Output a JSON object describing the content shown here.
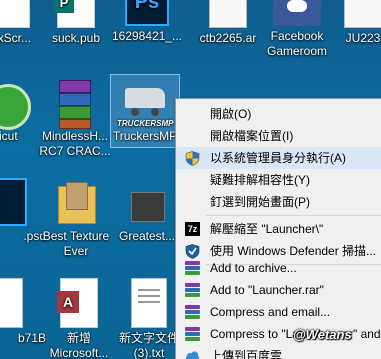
{
  "desktop": {
    "icons": [
      {
        "name": "oxscr-icon",
        "label": "oxScr..."
      },
      {
        "name": "suck-pub-icon",
        "label": "suck.pub"
      },
      {
        "name": "psd-16298421-icon",
        "label": "16298421_..."
      },
      {
        "name": "ctb2265-icon",
        "label": "ctb2265.ar"
      },
      {
        "name": "facebook-gameroom-icon",
        "label1": "Facebook",
        "label2": "Gameroom"
      },
      {
        "name": "ju223-icon",
        "label": "JU223"
      },
      {
        "name": "dicut-icon",
        "label": "dicut"
      },
      {
        "name": "mindlessh-icon",
        "label1": "MindlessH...",
        "label2": "RC7 CRAC..."
      },
      {
        "name": "truckersmp-icon",
        "label": "TruckersMP"
      },
      {
        "name": "psd-left-icon",
        "label": ".psd"
      },
      {
        "name": "best-texture-icon",
        "label1": "Best Texture",
        "label2": "Ever"
      },
      {
        "name": "greatest-icon",
        "label": "Greatest..."
      },
      {
        "name": "b71b-icon",
        "label": "b71B"
      },
      {
        "name": "new-microsoft-icon",
        "label1": "新增",
        "label2": "Microsoft..."
      },
      {
        "name": "new-text-icon",
        "label1": "新文字文件",
        "label2": "(3).txt"
      }
    ],
    "truckers_logo_text": "TRUCKERSMP"
  },
  "context_menu": {
    "items": [
      {
        "label": "開啟(O)",
        "icon": ""
      },
      {
        "label": "開啟檔案位置(I)",
        "icon": ""
      },
      {
        "label": "以系統管理員身分執行(A)",
        "icon": "uac-shield-icon"
      },
      {
        "label": "疑難排解相容性(Y)",
        "icon": ""
      },
      {
        "label": "釘選到開始畫面(P)",
        "icon": ""
      },
      {
        "label": "解壓縮至 \"Launcher\\\"",
        "icon": "7zip-icon"
      },
      {
        "label": "使用 Windows Defender 掃描...",
        "icon": "windows-defender-icon"
      },
      {
        "label": "Add to archive...",
        "icon": "winrar-icon"
      },
      {
        "label": "Add to \"Launcher.rar\"",
        "icon": "winrar-icon"
      },
      {
        "label": "Compress and email...",
        "icon": "winrar-icon"
      },
      {
        "label": "Compress to \"Launcher.rar\" and",
        "icon": "winrar-icon"
      },
      {
        "label": "上傳到百度雲",
        "icon": "baidu-cloud-icon"
      }
    ]
  },
  "watermark": "@Wetans",
  "colors": {
    "desktop": "#0c6da2",
    "menu": "#f0f0f0",
    "hover": "#d8e6f5"
  }
}
